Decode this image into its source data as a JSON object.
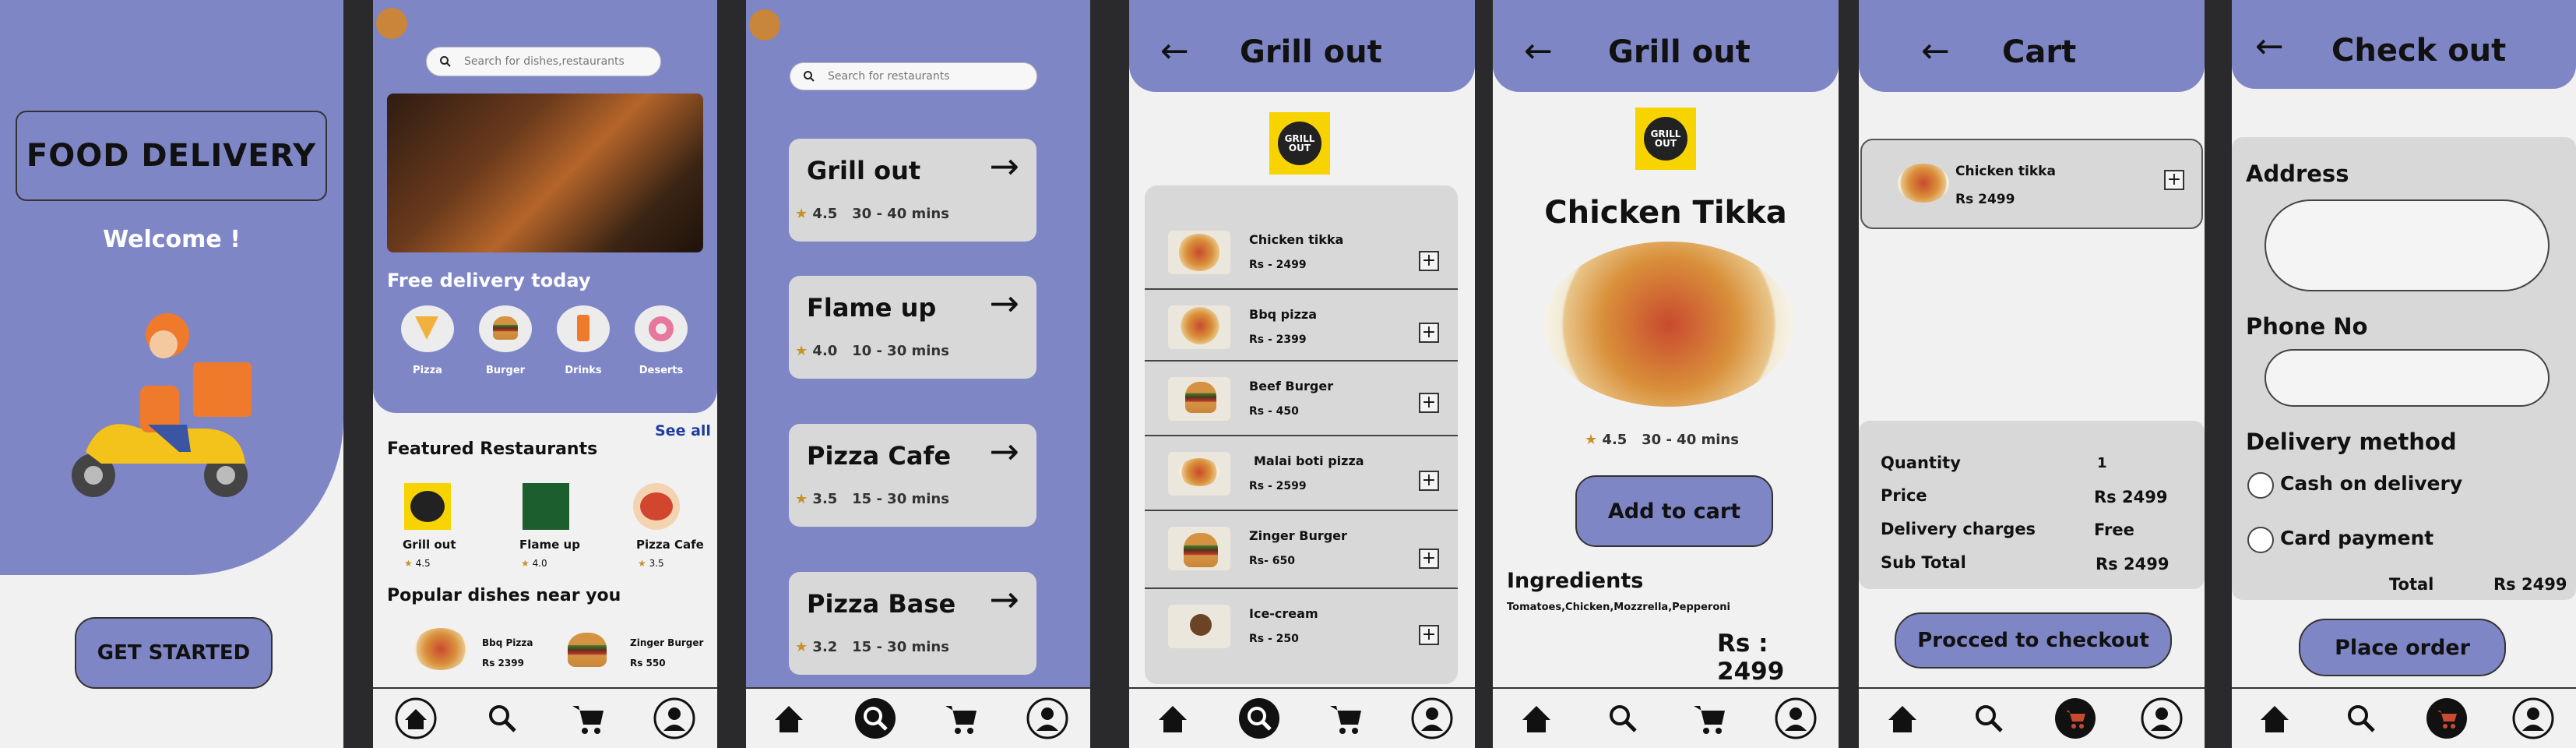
{
  "screen1": {
    "title": "FOOD DELIVERY",
    "welcome": "Welcome !",
    "cta": "GET STARTED"
  },
  "screen2": {
    "search_placeholder": "Search for dishes,restaurants",
    "promo_title": "Free delivery today",
    "categories": [
      "Pizza",
      "Burger",
      "Drinks",
      "Deserts"
    ],
    "featured_title": "Featured Restaurants",
    "see_all": "See all",
    "featured": [
      {
        "name": "Grill out",
        "rating": "4.5"
      },
      {
        "name": "Flame up",
        "rating": "4.0"
      },
      {
        "name": "Pizza Cafe",
        "rating": "3.5"
      }
    ],
    "popular_title": "Popular dishes near you",
    "popular": [
      {
        "name": "Bbq Pizza",
        "price": "Rs 2399"
      },
      {
        "name": "Zinger Burger",
        "price": "Rs 550"
      }
    ]
  },
  "screen3": {
    "search_placeholder": "Search for restaurants",
    "restaurants": [
      {
        "name": "Grill out",
        "rating": "4.5",
        "time": "30 - 40  mins"
      },
      {
        "name": "Flame up",
        "rating": "4.0",
        "time": "10 - 30  mins"
      },
      {
        "name": "Pizza Cafe",
        "rating": "3.5",
        "time": "15 - 30  mins"
      },
      {
        "name": "Pizza Base",
        "rating": "3.2",
        "time": "15 - 30  mins"
      }
    ]
  },
  "screen4": {
    "title": "Grill out",
    "logo_text": "GRILL OUT",
    "items": [
      {
        "name": "Chicken tikka",
        "price": "Rs - 2499"
      },
      {
        "name": "Bbq pizza",
        "price": "Rs - 2399"
      },
      {
        "name": "Beef Burger",
        "price": "Rs - 450"
      },
      {
        "name": "Malai boti pizza",
        "price": "Rs - 2599"
      },
      {
        "name": "Zinger Burger",
        "price": "Rs- 650"
      },
      {
        "name": "Ice-cream",
        "price": "Rs - 250"
      }
    ]
  },
  "screen5": {
    "title": "Grill out",
    "dish": "Chicken Tikka",
    "rating": "4.5",
    "time": "30 - 40  mins",
    "add_to_cart": "Add to cart",
    "ingredients_title": "Ingredients",
    "ingredients": "Tomatoes,Chicken,Mozzrella,Pepperoni",
    "price": "Rs : 2499"
  },
  "screen6": {
    "title": "Cart",
    "item_name": "Chicken tikka",
    "item_price": "Rs 2499",
    "summary": [
      {
        "label": "Quantity",
        "value": "1"
      },
      {
        "label": "Price",
        "value": "Rs  2499"
      },
      {
        "label": "Delivery charges",
        "value": "Free"
      },
      {
        "label": "Sub Total",
        "value": "Rs 2499"
      }
    ],
    "checkout": "Procced to checkout"
  },
  "screen7": {
    "title": "Check out",
    "address_label": "Address",
    "phone_label": "Phone No",
    "delivery_label": "Delivery method",
    "option_cash": "Cash on delivery",
    "option_card": "Card payment",
    "total_label": "Total",
    "total_value": "Rs 2499",
    "place_order": "Place order"
  },
  "colors": {
    "accent": "#7f86c6",
    "panel": "#d8d8d8",
    "background": "#f1f1f1",
    "star": "#c8912a"
  },
  "icons": [
    "home-icon",
    "search-icon",
    "cart-icon",
    "profile-icon",
    "back-arrow-icon",
    "forward-arrow-icon",
    "plus-icon"
  ]
}
